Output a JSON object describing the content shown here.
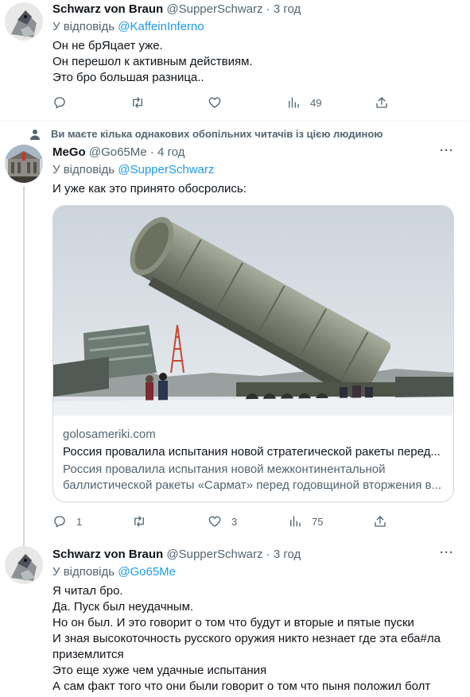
{
  "tweets": [
    {
      "name": "Schwarz von Braun",
      "handle": "@SupperSchwarz",
      "time": "3 год",
      "reply_prefix": "У відповідь",
      "reply_to": "@KaffeinInferno",
      "lines": [
        "Он не брЯцает уже.",
        "Он перешол к активным действиям.",
        "Это бро большая разница.."
      ],
      "replies": "",
      "retweets": "",
      "likes": "",
      "views": "49"
    },
    {
      "social_context": "Ви маєте кілька однакових обопільних читачів із цією людиною",
      "name": "MeGo",
      "handle": "@Go65Me",
      "time": "4 год",
      "reply_prefix": "У відповідь",
      "reply_to": "@SupperSchwarz",
      "lines": [
        "И уже как это принято обосролись:"
      ],
      "card": {
        "domain": "golosameriki.com",
        "title": "Россия провалила испытания новой стратегической ракеты перед...",
        "description_1": "Россия провалила испытания новой межконтинентальной",
        "description_2": "баллистической ракеты «Сармат» перед годовщиной вторжения в..."
      },
      "replies": "1",
      "retweets": "",
      "likes": "3",
      "views": "75"
    },
    {
      "name": "Schwarz von Braun",
      "handle": "@SupperSchwarz",
      "time": "3 год",
      "reply_prefix": "У відповідь",
      "reply_to": "@Go65Me",
      "lines": [
        "Я читал бро.",
        "Да. Пуск был неудачным.",
        "Но он был. И это говорит о том что будут и вторые и пятые пуски",
        "И зная высокоточность русского оружия никто незнает где эта еба#ла",
        "приземлится",
        "Это еще хуже чем удачные испытания",
        "А сам факт того что они были говорит о том что пыня положил болт"
      ]
    }
  ],
  "separator": "·",
  "colors": {
    "link": "#1d9bf0",
    "secondary": "#536471",
    "text": "#0f1419",
    "border": "#cfd9de"
  },
  "icons": [
    "reply-icon",
    "retweet-icon",
    "like-icon",
    "views-icon",
    "share-icon",
    "more-icon",
    "person-icon"
  ]
}
